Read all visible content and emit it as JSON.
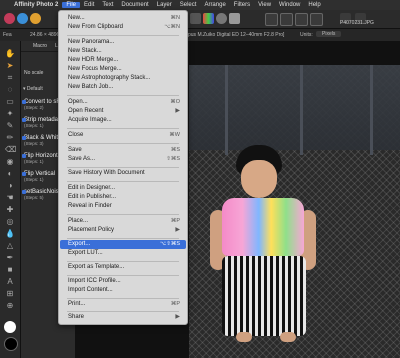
{
  "menubar": {
    "items": [
      "Affinity Photo 2",
      "File",
      "Edit",
      "Text",
      "Document",
      "Layer",
      "Select",
      "Arrange",
      "Filters",
      "View",
      "Window",
      "Help"
    ]
  },
  "context_bar": {
    "zoom": "Fea",
    "info": "24.86 × 4896px 7.03m ch",
    "lens": "pus M.Zuiko Digital ED 12–40mm F2.8 Pro]",
    "units_label": "Units:",
    "units_value": "Pixels",
    "file_name": "P4070231.JPG"
  },
  "panel": {
    "tab_macros": "Macro",
    "tab_library": "Libra",
    "no_scale": "No scale",
    "category": "Default",
    "macros": [
      {
        "name": "Convert to sR",
        "steps": "(Steps: 2)"
      },
      {
        "name": "Strip metadat",
        "steps": "(Steps: 1)"
      },
      {
        "name": "Black & White",
        "steps": "(Steps: 3)"
      },
      {
        "name": "Flip Horizonta",
        "steps": "(Steps: 1)"
      },
      {
        "name": "Flip Vertical",
        "steps": "(Steps: 1)"
      },
      {
        "name": "setBasicNoise",
        "steps": "(Steps: 5)"
      }
    ]
  },
  "file_menu": {
    "items": [
      {
        "label": "New...",
        "shortcut": "⌘N"
      },
      {
        "label": "New From Clipboard",
        "shortcut": "⌥⌘N"
      },
      {
        "label": "New Panorama...",
        "shortcut": ""
      },
      {
        "label": "New Stack...",
        "shortcut": ""
      },
      {
        "label": "New HDR Merge...",
        "shortcut": ""
      },
      {
        "label": "New Focus Merge...",
        "shortcut": ""
      },
      {
        "label": "New Astrophotography Stack...",
        "shortcut": ""
      },
      {
        "label": "New Batch Job...",
        "shortcut": ""
      },
      {
        "label": "Open...",
        "shortcut": "⌘O"
      },
      {
        "label": "Open Recent",
        "shortcut": ""
      },
      {
        "label": "Acquire Image...",
        "shortcut": ""
      },
      {
        "label": "Close",
        "shortcut": "⌘W"
      },
      {
        "label": "Save",
        "shortcut": "⌘S"
      },
      {
        "label": "Save As...",
        "shortcut": "⇧⌘S"
      },
      {
        "label": "Save History With Document",
        "shortcut": ""
      },
      {
        "label": "Edit in Designer...",
        "shortcut": ""
      },
      {
        "label": "Edit in Publisher...",
        "shortcut": ""
      },
      {
        "label": "Reveal in Finder",
        "shortcut": ""
      },
      {
        "label": "Place...",
        "shortcut": "⌘P"
      },
      {
        "label": "Placement Policy",
        "shortcut": ""
      },
      {
        "label": "Export...",
        "shortcut": "⌥⇧⌘S"
      },
      {
        "label": "Export LUT...",
        "shortcut": ""
      },
      {
        "label": "Export as Template...",
        "shortcut": ""
      },
      {
        "label": "Import ICC Profile...",
        "shortcut": ""
      },
      {
        "label": "Import Content...",
        "shortcut": ""
      },
      {
        "label": "Print...",
        "shortcut": "⌘P"
      },
      {
        "label": "Share",
        "shortcut": ""
      }
    ]
  }
}
